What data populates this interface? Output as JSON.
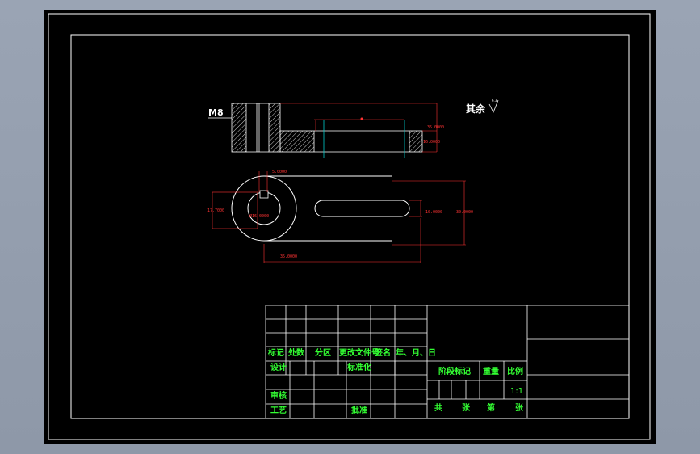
{
  "drawing": {
    "thread_label": "M8",
    "surface_note": "其余",
    "surface_symbol_value": "6.3",
    "dims": {
      "top_height_1": "35.0000",
      "top_height_2": "16.0000",
      "keyway_width": "5.0000",
      "outer_height": "17.7000",
      "bore_diameter": "Ø16.0000",
      "slot_width": "10.0000",
      "overall_width": "30.0000",
      "center_distance": "35.0000"
    }
  },
  "title_block": {
    "mark": "标记",
    "count": "处数",
    "zone": "分区",
    "change_doc": "更改文件号",
    "signature": "签名",
    "date": "年、月、日",
    "design": "设计",
    "standardize": "标准化",
    "stage_mark": "阶段标记",
    "weight": "重量",
    "scale": "比例",
    "scale_value": "1:1",
    "review": "审核",
    "process": "工艺",
    "approve": "批准",
    "total": "共",
    "sheets": "张",
    "number": "第",
    "sheet": "张"
  },
  "colors": {
    "background": "#000000",
    "frame": "#ffffff",
    "dimension": "#ff3333",
    "centerline": "#00cccc",
    "title_text": "#33ff33"
  }
}
